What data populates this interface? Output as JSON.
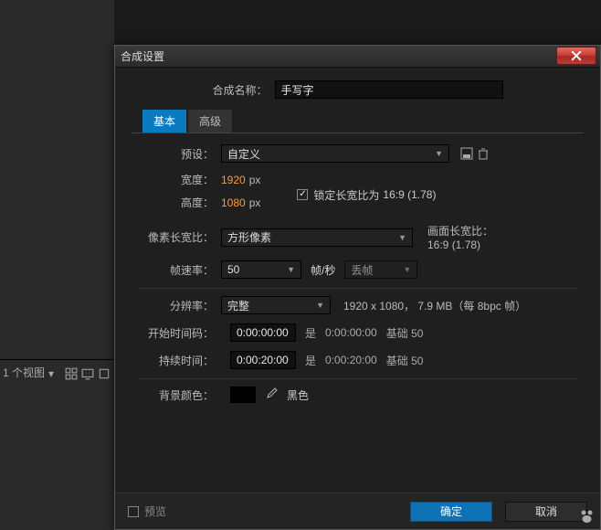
{
  "background": {
    "views_label": "1 个视图"
  },
  "dialog": {
    "title": "合成设置",
    "name_label": "合成名称：",
    "name_value": "手写字",
    "tabs": {
      "basic": "基本",
      "advanced": "高级"
    },
    "preset": {
      "label": "预设：",
      "value": "自定义"
    },
    "width": {
      "label": "宽度：",
      "value": "1920",
      "unit": "px"
    },
    "height": {
      "label": "高度：",
      "value": "1080",
      "unit": "px"
    },
    "lock_ratio": {
      "label": "锁定长宽比为",
      "ratio": "16:9 (1.78)"
    },
    "par": {
      "label": "像素长宽比：",
      "value": "方形像素",
      "frame_ratio_label": "画面长宽比：",
      "frame_ratio_value": "16:9 (1.78)"
    },
    "fps": {
      "label": "帧速率：",
      "value": "50",
      "unit_label": "帧/秒",
      "drop": "丢帧"
    },
    "res": {
      "label": "分辨率：",
      "value": "完整",
      "info": "1920 x 1080， 7.9 MB（每 8bpc 帧）"
    },
    "start_tc": {
      "label": "开始时间码：",
      "value": "0:00:00:00",
      "is": "是",
      "ref": "0:00:00:00",
      "base": "基础 50"
    },
    "duration": {
      "label": "持续时间：",
      "value": "0:00:20:00",
      "is": "是",
      "ref": "0:00:20:00",
      "base": "基础 50"
    },
    "bg": {
      "label": "背景颜色：",
      "name": "黑色",
      "swatch": "#000000"
    },
    "footer": {
      "preview": "预览",
      "ok": "确定",
      "cancel": "取消"
    }
  }
}
